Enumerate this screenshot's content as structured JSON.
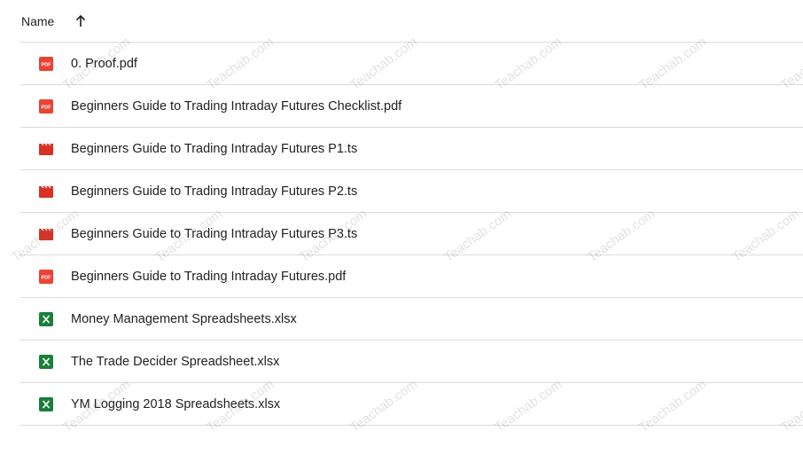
{
  "header": {
    "name_label": "Name",
    "sort_icon": "arrow-up-icon"
  },
  "files": [
    {
      "name": "0. Proof.pdf",
      "icon": "pdf-icon"
    },
    {
      "name": "Beginners Guide to Trading Intraday Futures Checklist.pdf",
      "icon": "pdf-icon"
    },
    {
      "name": "Beginners Guide to Trading Intraday Futures P1.ts",
      "icon": "video-icon"
    },
    {
      "name": "Beginners Guide to Trading Intraday Futures P2.ts",
      "icon": "video-icon"
    },
    {
      "name": "Beginners Guide to Trading Intraday Futures P3.ts",
      "icon": "video-icon"
    },
    {
      "name": "Beginners Guide to Trading Intraday Futures.pdf",
      "icon": "pdf-icon"
    },
    {
      "name": "Money Management Spreadsheets.xlsx",
      "icon": "spreadsheet-icon"
    },
    {
      "name": "The Trade Decider Spreadsheet.xlsx",
      "icon": "spreadsheet-icon"
    },
    {
      "name": "YM Logging 2018 Spreadsheets.xlsx",
      "icon": "spreadsheet-icon"
    }
  ],
  "watermark": "Teachab.com",
  "colors": {
    "pdf": "#ea4335",
    "video": "#d93025",
    "spreadsheet": "#188038",
    "divider": "#dadce0"
  }
}
